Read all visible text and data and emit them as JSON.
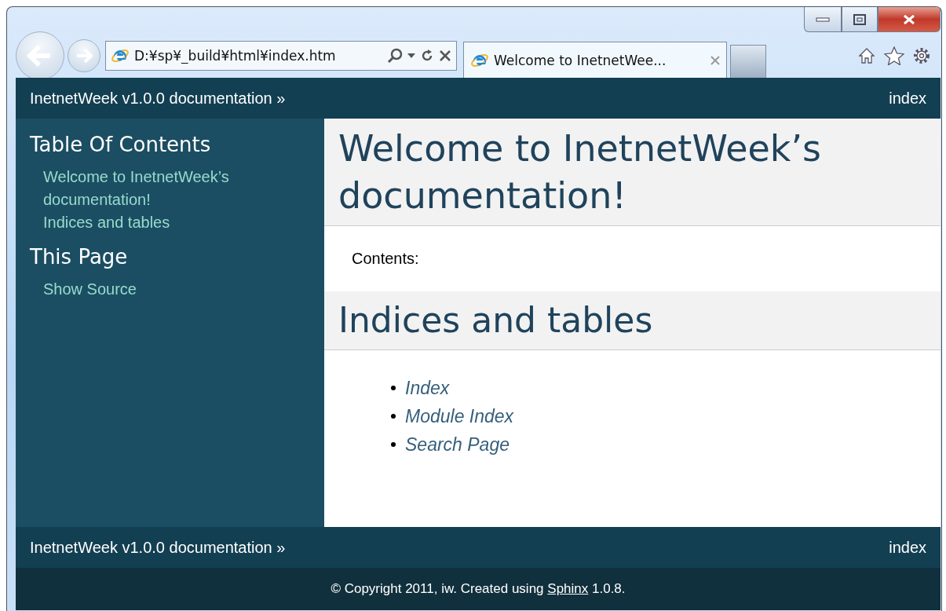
{
  "browser": {
    "address": "D:¥sp¥_build¥html¥index.htm",
    "tabs": [
      {
        "title": "Welcome to InetnetWee...",
        "selected": true
      }
    ]
  },
  "relbar_top": {
    "title": "InetnetWeek v1.0.0 documentation »",
    "link": "index"
  },
  "sidebar": {
    "sections": [
      {
        "heading": "Table Of Contents",
        "links": [
          "Welcome to InetnetWeek’s documentation!",
          "Indices and tables"
        ]
      },
      {
        "heading": "This Page",
        "links": [
          "Show Source"
        ]
      }
    ]
  },
  "content": {
    "title": "Welcome to InetnetWeek’s documentation!",
    "contents_label": "Contents:",
    "section_title": "Indices and tables",
    "list": [
      "Index",
      "Module Index",
      "Search Page"
    ]
  },
  "relbar_bottom": {
    "title": "InetnetWeek v1.0.0 documentation »",
    "link": "index"
  },
  "footer": {
    "before": "© Copyright 2011, iw. Created using",
    "link": "Sphinx",
    "after": "1.0.8."
  }
}
